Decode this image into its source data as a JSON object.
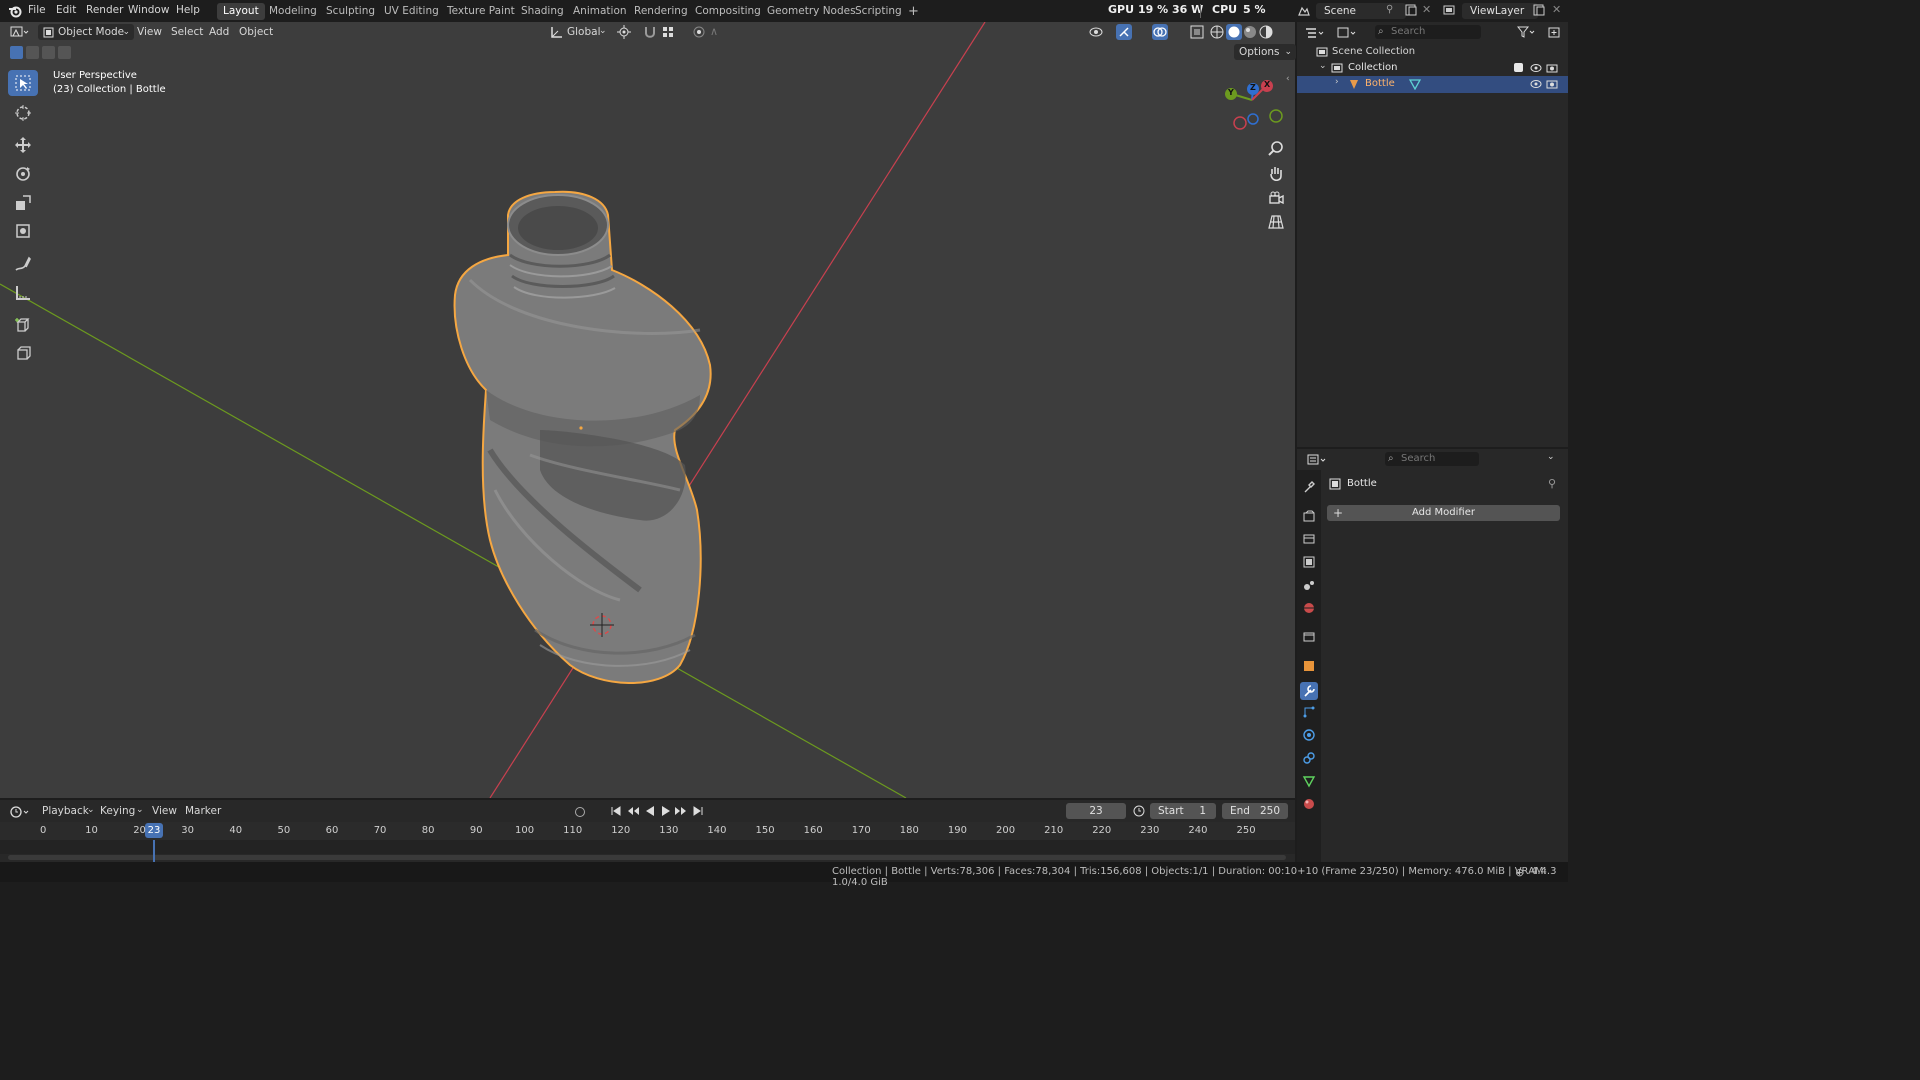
{
  "top_menu": [
    "File",
    "Edit",
    "Render",
    "Window",
    "Help"
  ],
  "workspaces": [
    "Layout",
    "Modeling",
    "Sculpting",
    "UV Editing",
    "Texture Paint",
    "Shading",
    "Animation",
    "Rendering",
    "Compositing",
    "Geometry Nodes",
    "Scripting"
  ],
  "active_workspace": "Layout",
  "add_workspace": "+",
  "stats": {
    "gpu_label": "GPU",
    "gpu_value": "19 % 36 W",
    "cpu_label": "CPU",
    "cpu_value": "5 %"
  },
  "scene_field": "Scene",
  "view_layer_field": "ViewLayer",
  "viewport": {
    "mode": "Object Mode",
    "menus": [
      "View",
      "Select",
      "Add",
      "Object"
    ],
    "orientation": "Global",
    "options_label": "Options",
    "perspective_label": "User Perspective",
    "context_label": "(23) Collection | Bottle",
    "gizmo": {
      "x": "X",
      "y": "Y",
      "z": "Z"
    }
  },
  "outliner": {
    "search_placeholder": "Search",
    "scene_collection": "Scene Collection",
    "collection": "Collection",
    "object": "Bottle"
  },
  "properties": {
    "search_placeholder": "Search",
    "object_name": "Bottle",
    "add_modifier": "Add Modifier"
  },
  "timeline": {
    "menus": [
      "Playback",
      "Keying",
      "View",
      "Marker"
    ],
    "current_frame": "23",
    "start_label": "Start",
    "start_value": "1",
    "end_label": "End",
    "end_value": "250",
    "ticks": [
      "0",
      "10",
      "20",
      "30",
      "40",
      "50",
      "60",
      "70",
      "80",
      "90",
      "100",
      "110",
      "120",
      "130",
      "140",
      "150",
      "160",
      "170",
      "180",
      "190",
      "200",
      "210",
      "220",
      "230",
      "240",
      "250"
    ],
    "playhead_label": "23"
  },
  "status_bar": {
    "text": "Collection | Bottle | Verts:78,306 | Faces:78,304 | Tris:156,608 | Objects:1/1 | Duration: 00:10+10 (Frame 23/250) | Memory: 476.0 MiB | VRAM: 1.0/4.0 GiB",
    "version": "4.4.3"
  },
  "colors": {
    "accent": "#4772b3",
    "selection_outline": "#f5a742",
    "axis_x": "#c8404f",
    "axis_y": "#6c9a1f",
    "viewport_bg": "#3d3d3d"
  }
}
